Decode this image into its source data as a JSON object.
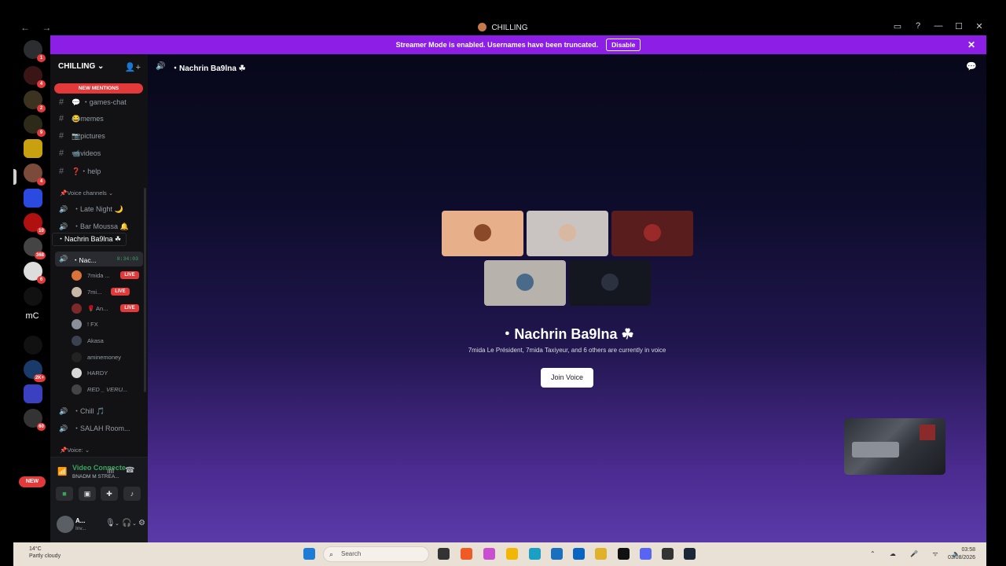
{
  "titlebar": {
    "title": "CHILLING",
    "nav": "← →",
    "icons": [
      "inbox-icon",
      "help-icon",
      "minimize-icon",
      "maximize-icon",
      "close-icon"
    ]
  },
  "banner": {
    "text": "Streamer Mode is enabled. Usernames have been truncated.",
    "button": "Disable",
    "close": "✕"
  },
  "rail": {
    "servers": [
      {
        "badge": "1"
      },
      {
        "badge": "4"
      },
      {
        "badge": "2"
      },
      {
        "badge": "9"
      },
      {
        "badge": ""
      },
      {
        "badge": "4"
      },
      {
        "badge": ""
      },
      {
        "badge": "10"
      },
      {
        "badge": "368"
      },
      {
        "badge": "6"
      },
      {
        "badge": ""
      },
      {
        "badge": ""
      },
      {
        "badge": ""
      },
      {
        "badge": "2K+"
      },
      {
        "badge": ""
      },
      {
        "badge": "60"
      }
    ],
    "mc_label": "mC",
    "new_label": "NEW"
  },
  "sidebar": {
    "server_name": "CHILLING",
    "new_mentions": "NEW MENTIONS",
    "text_channels": [
      "💬 ・games-chat",
      "😂memes",
      "📷pictures",
      "📹videos",
      "❓・help"
    ],
    "voice_category": "📌Voice channels ⌄",
    "voice_channels": [
      "・Late Night 🌙",
      "・Bar Moussa 🔔"
    ],
    "hover_label": "・Nachrin Ba9lna ☘",
    "active_channel": {
      "name": "・Nac...",
      "timer": "8:34:03"
    },
    "voice_users": [
      {
        "name": "7mida ...",
        "live": "LIVE",
        "color": "#d9733a"
      },
      {
        "name": "7mi...",
        "live": "LIVE",
        "color": "#c9b8a6"
      },
      {
        "name": "🌹 An...",
        "live": "LIVE",
        "color": "#7a2a2a"
      },
      {
        "name": "! FX",
        "live": "",
        "color": "#8a8f99"
      },
      {
        "name": "Akasa",
        "live": "",
        "color": "#3c4150"
      },
      {
        "name": "aminemoney",
        "live": "",
        "color": "#222"
      },
      {
        "name": "HARDY",
        "live": "",
        "color": "#d7d7d7"
      },
      {
        "name": "RED _ VERU...",
        "live": "",
        "color": "#444"
      }
    ],
    "more_channels": [
      "・Chill 🎵",
      "・SALAH Room..."
    ],
    "voice2_category": "📌Voice: ⌄",
    "voice_connected": {
      "title": "Video Connecte",
      "subtitle": "BNADM M STREA..."
    },
    "user": {
      "name": "A...",
      "status": "Inv..."
    }
  },
  "main": {
    "channel_header": "・Nachrin Ba9lna ☘",
    "voice_title": "・Nachrin Ba9lna ☘",
    "voice_subtitle": "7mida Le Président, 7mida Taxiyeur, and 6 others are currently in voice",
    "join_button": "Join Voice",
    "tiles": [
      {
        "bg": "#e8b08a",
        "face": "#8a4a2a"
      },
      {
        "bg": "#c9c4c1",
        "face": "#d8b8a0"
      },
      {
        "bg": "#5a1d1d",
        "face": "#9a2a2a"
      },
      {
        "bg": "#b7b2ab",
        "face": "#4a6a8a"
      },
      {
        "bg": "#141720",
        "face": "#2c3140"
      }
    ]
  },
  "taskbar": {
    "weather_temp": "14°C",
    "weather_desc": "Partly cloudy",
    "search_placeholder": "Search",
    "time": "03:58",
    "date": "03/08/2026",
    "tray": "⌃ ☁ 🎤 ᯤ 🔈"
  }
}
